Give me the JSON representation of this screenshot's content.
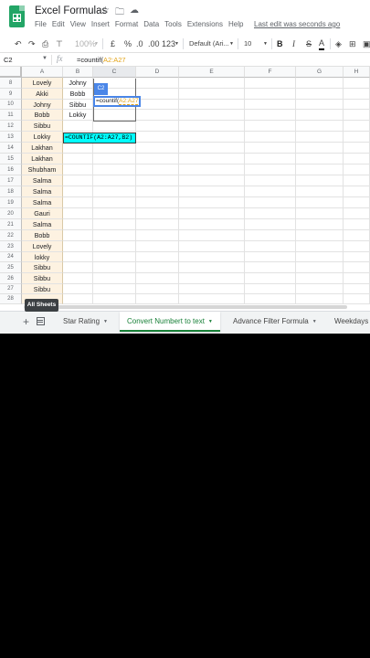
{
  "app": {
    "title": "Excel Formulas",
    "last_edit": "Last edit was seconds ago",
    "menu": [
      "File",
      "Edit",
      "View",
      "Insert",
      "Format",
      "Data",
      "Tools",
      "Extensions",
      "Help"
    ]
  },
  "toolbar": {
    "zoom": "100%",
    "currency": "£",
    "percent": "%",
    "dec_decrease": ".0",
    "dec_increase": ".00",
    "more_formats": "123",
    "font": "Default (Ari...",
    "font_size": "10",
    "bold": "B",
    "italic": "I",
    "strike": "S",
    "text_color": "A"
  },
  "formula_bar": {
    "cell_ref": "C2",
    "fx": "fx",
    "formula_prefix": "=countif(",
    "formula_range": "A2:A27"
  },
  "columns": [
    "A",
    "B",
    "C",
    "D",
    "E",
    "F",
    "G",
    "H"
  ],
  "rows": [
    {
      "num": "8",
      "a": "Lovely",
      "b": "Johny"
    },
    {
      "num": "9",
      "a": "Akki",
      "b": "Bobb"
    },
    {
      "num": "10",
      "a": "Johny",
      "b": "Sibbu"
    },
    {
      "num": "11",
      "a": "Bobb",
      "b": "Lokky"
    },
    {
      "num": "12",
      "a": "Sibbu",
      "b": ""
    },
    {
      "num": "13",
      "a": "Lokky",
      "b": ""
    },
    {
      "num": "14",
      "a": "Lakhan",
      "b": ""
    },
    {
      "num": "15",
      "a": "Lakhan",
      "b": ""
    },
    {
      "num": "16",
      "a": "Shubham",
      "b": ""
    },
    {
      "num": "17",
      "a": "Salma",
      "b": ""
    },
    {
      "num": "18",
      "a": "Salma",
      "b": ""
    },
    {
      "num": "19",
      "a": "Salma",
      "b": ""
    },
    {
      "num": "20",
      "a": "Gauri",
      "b": ""
    },
    {
      "num": "21",
      "a": "Salma",
      "b": ""
    },
    {
      "num": "22",
      "a": "Bobb",
      "b": ""
    },
    {
      "num": "23",
      "a": "Lovely",
      "b": ""
    },
    {
      "num": "24",
      "a": "lokky",
      "b": ""
    },
    {
      "num": "25",
      "a": "Sibbu",
      "b": ""
    },
    {
      "num": "26",
      "a": "Sibbu",
      "b": ""
    },
    {
      "num": "27",
      "a": "Sibbu",
      "b": ""
    },
    {
      "num": "28",
      "a": "",
      "b": ""
    }
  ],
  "cell_edit": {
    "label": "C2",
    "prefix": "=countif(",
    "range": "A2:A27"
  },
  "formula_banner": "=COUNTIF(A2:A27,B2)",
  "sheets": {
    "tooltip": "All Sheets",
    "tabs": [
      {
        "label": "Star Rating",
        "active": false
      },
      {
        "label": "Convert Numbert to text",
        "active": true
      },
      {
        "label": "Advance Filter Formula",
        "active": false
      },
      {
        "label": "Weekdays",
        "active": false
      }
    ]
  },
  "colors": {
    "brand_green": "#23a566",
    "selection_blue": "#4a86e8",
    "banner_cyan": "#00ffff",
    "range_highlight": "#fdf2e1",
    "active_tab": "#188038"
  }
}
